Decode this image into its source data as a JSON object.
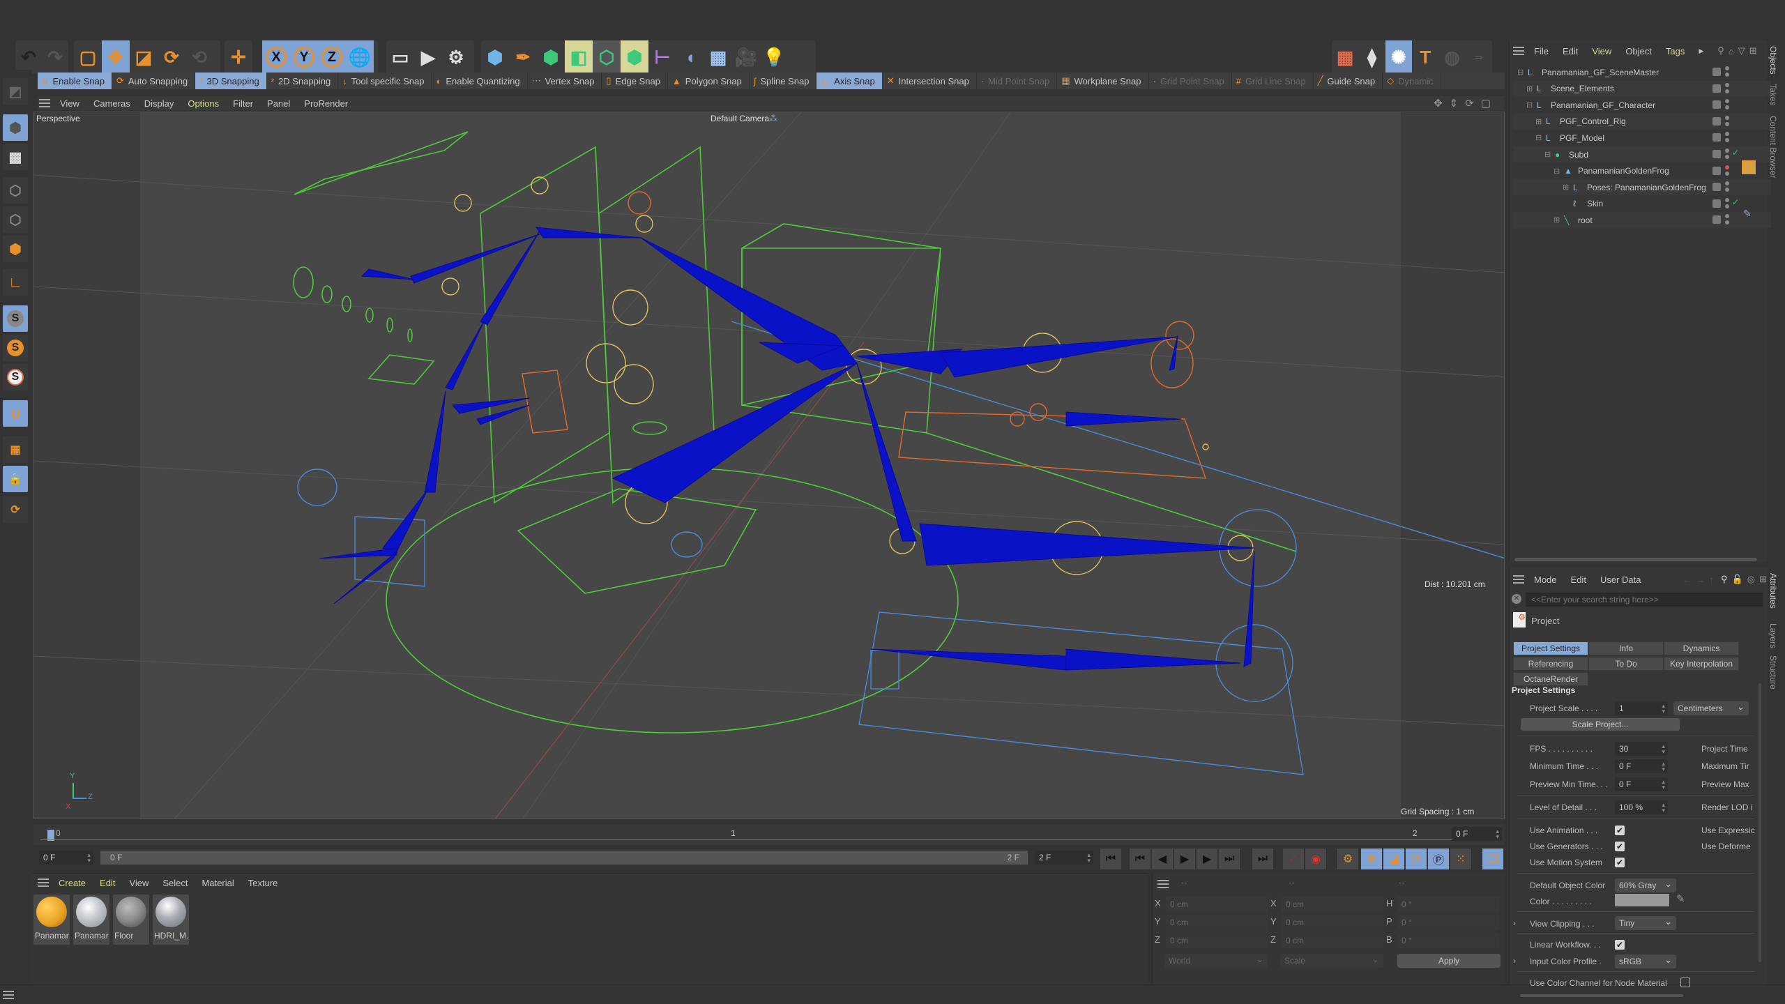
{
  "toolbar": {
    "icons": [
      "undo-icon",
      "redo-icon",
      "live-selection-icon",
      "move-icon",
      "scale-icon",
      "rotate-icon",
      "psr-icon",
      "add-icon",
      "x-axis-icon",
      "y-axis-icon",
      "z-axis-icon",
      "coordinate-system-icon",
      "render-view-icon",
      "render-picture-viewer-icon",
      "render-settings-icon",
      "cube-icon",
      "pen-icon",
      "subdivision-icon",
      "extrude-icon",
      "connect-icon",
      "array-icon",
      "symmetry-icon",
      "deformer-icon",
      "floor-icon",
      "camera-icon",
      "light-icon",
      "xpresso-icon",
      "sculpt-icon",
      "octane-icon",
      "text-icon",
      "null-icon",
      "xyz-icon"
    ],
    "axis_labels": {
      "x": "X",
      "y": "Y",
      "z": "Z"
    },
    "text_tool_glyph": "T"
  },
  "snap_bar": {
    "items": [
      {
        "label": "Enable Snap",
        "active": true,
        "disabled": false
      },
      {
        "label": "Auto Snapping",
        "active": false,
        "disabled": false
      },
      {
        "label": "3D Snapping",
        "active": true,
        "disabled": false
      },
      {
        "label": "2D Snapping",
        "active": false,
        "disabled": false
      },
      {
        "label": "Tool specific Snap",
        "active": false,
        "disabled": false
      },
      {
        "label": "Enable Quantizing",
        "active": false,
        "disabled": false
      },
      {
        "label": "Vertex Snap",
        "active": false,
        "disabled": false
      },
      {
        "label": "Edge Snap",
        "active": false,
        "disabled": false
      },
      {
        "label": "Polygon Snap",
        "active": false,
        "disabled": false
      },
      {
        "label": "Spline Snap",
        "active": false,
        "disabled": false
      },
      {
        "label": "Axis Snap",
        "active": true,
        "disabled": false
      },
      {
        "label": "Intersection Snap",
        "active": false,
        "disabled": false
      },
      {
        "label": "Mid Point Snap",
        "active": false,
        "disabled": true
      },
      {
        "label": "Workplane Snap",
        "active": false,
        "disabled": false
      },
      {
        "label": "Grid Point Snap",
        "active": false,
        "disabled": true
      },
      {
        "label": "Grid Line Snap",
        "active": false,
        "disabled": true
      },
      {
        "label": "Guide Snap",
        "active": false,
        "disabled": false
      },
      {
        "label": "Dynamic",
        "active": false,
        "disabled": true
      }
    ]
  },
  "viewport": {
    "menu": [
      "View",
      "Cameras",
      "Display",
      "Options",
      "Filter",
      "Panel",
      "ProRender"
    ],
    "highlighted_menu": "Options",
    "view_name": "Perspective",
    "camera_label": "Default Camera",
    "dist_readout": "Dist : 10.201 cm",
    "grid_spacing": "Grid Spacing : 1 cm",
    "axis_gizmo": {
      "x": "X",
      "y": "Y",
      "z": "Z"
    },
    "colors": {
      "bones": "#0a12c8",
      "guides": "#4ec93a",
      "controls": "#e0c060",
      "handles": "#e06a2a",
      "helpers": "#4a8ad8",
      "axis_line": "#c04cc0"
    }
  },
  "left_toolbar": {
    "icons": [
      "make-editable-icon",
      "model-mode-icon",
      "texture-mode-icon",
      "points-mode-icon",
      "edges-mode-icon",
      "polygons-mode-icon",
      "axis-mode-icon",
      "solo-off-icon",
      "solo-single-icon",
      "solo-hierarchy-icon",
      "snap-magnet-icon",
      "workplane-icon",
      "locked-workplane-icon",
      "align-workplane-icon"
    ],
    "solo_glyph": "S"
  },
  "object_manager": {
    "menu": [
      "File",
      "Edit",
      "View",
      "Object",
      "Tags"
    ],
    "highlighted_menus": [
      "View",
      "Tags"
    ],
    "side_tabs": [
      "Objects",
      "Takes",
      "Content Browser"
    ],
    "objects": [
      {
        "name": "Panamanian_GF_SceneMaster",
        "depth": 0,
        "expander": "minus",
        "icon": "null-icon",
        "check": false,
        "dot": "gray"
      },
      {
        "name": "Scene_Elements",
        "depth": 1,
        "expander": "plus",
        "icon": "null-icon",
        "check": false,
        "dot": "gray"
      },
      {
        "name": "Panamanian_GF_Character",
        "depth": 1,
        "expander": "minus",
        "icon": "null-icon",
        "check": false,
        "dot": "gray"
      },
      {
        "name": "PGF_Control_Rig",
        "depth": 2,
        "expander": "plus",
        "icon": "null-icon",
        "check": false,
        "dot": "gray"
      },
      {
        "name": "PGF_Model",
        "depth": 2,
        "expander": "minus",
        "icon": "null-icon",
        "check": false,
        "dot": "gray"
      },
      {
        "name": "Subd",
        "depth": 3,
        "expander": "minus",
        "icon": "subdivision-surface-icon",
        "check": true,
        "dot": "gray"
      },
      {
        "name": "PanamanianGoldenFrog",
        "depth": 4,
        "expander": "minus",
        "icon": "polygon-object-icon",
        "check": false,
        "dot": "red"
      },
      {
        "name": "Poses: PanamanianGoldenFrog",
        "depth": 5,
        "expander": "plus",
        "icon": "null-icon",
        "check": false,
        "dot": "gray"
      },
      {
        "name": "Skin",
        "depth": 5,
        "expander": "none",
        "icon": "skin-icon",
        "check": true,
        "dot": "gray"
      },
      {
        "name": "root",
        "depth": 4,
        "expander": "plus",
        "icon": "joint-icon",
        "check": false,
        "dot": "gray"
      }
    ]
  },
  "attributes": {
    "menu": [
      "Mode",
      "Edit",
      "User Data"
    ],
    "side_tabs": [
      "Attributes",
      "Layers",
      "Structure"
    ],
    "search_placeholder": "<<Enter your search string here>>",
    "object_label": "Project",
    "tabs": [
      {
        "label": "Project Settings",
        "active": true
      },
      {
        "label": "Info",
        "active": false
      },
      {
        "label": "Dynamics",
        "active": false
      },
      {
        "label": "Referencing",
        "active": false
      },
      {
        "label": "To Do",
        "active": false
      },
      {
        "label": "Key Interpolation",
        "active": false
      },
      {
        "label": "OctaneRender",
        "active": false
      }
    ],
    "section_title": "Project Settings",
    "project_scale": {
      "label": "Project Scale . . . .",
      "value": "1",
      "unit": "Centimeters"
    },
    "scale_project_button": "Scale Project...",
    "fps": {
      "label": "FPS . . . . . . . . . .",
      "value": "30"
    },
    "min_time": {
      "label": "Minimum Time . . .",
      "value": "0 F"
    },
    "preview_min": {
      "label": "Preview Min Time. . .",
      "value": "0 F"
    },
    "lod": {
      "label": "Level of Detail . . .",
      "value": "100 %"
    },
    "right_labels": [
      "Project Time",
      "Maximum Tir",
      "Preview Max",
      "Render LOD i",
      "Use Expressic",
      "Use Deforme"
    ],
    "use_animation": {
      "label": "Use Animation . . .",
      "checked": true
    },
    "use_generators": {
      "label": "Use Generators . . .",
      "checked": true
    },
    "use_motion": {
      "label": "Use Motion System",
      "checked": true
    },
    "default_color": {
      "label": "Default Object Color",
      "value": "60% Gray"
    },
    "color": {
      "label": "Color . . . . . . . . .",
      "swatch": "#999999"
    },
    "view_clipping": {
      "label": "View Clipping . . .",
      "value": "Tiny"
    },
    "linear_workflow": {
      "label": "Linear Workflow. . .",
      "checked": true
    },
    "input_profile": {
      "label": "Input Color Profile .",
      "value": "sRGB"
    },
    "node_material": {
      "label": "Use Color Channel for Node Material",
      "checked": false
    },
    "check_glyph": "✔"
  },
  "timeline": {
    "ruler_start": "0",
    "ruler_mid": "1",
    "ruler_end": "2",
    "current_frame": "0 F",
    "range_start": "0 F",
    "range_end_label": "2 F",
    "max_frame": "2 F",
    "frame_right": "0 F",
    "progress": 0.0
  },
  "material_manager": {
    "menu": [
      "Create",
      "Edit",
      "View",
      "Select",
      "Material",
      "Texture"
    ],
    "highlighted_menus": [
      "Create",
      "Edit"
    ],
    "materials": [
      {
        "name": "Panamar",
        "swatch": "#e8a020"
      },
      {
        "name": "Panamar",
        "swatch": "#c8ccd0"
      },
      {
        "name": "Floor",
        "swatch": "#8a8a8a"
      },
      {
        "name": "HDRI_M.",
        "swatch": "#a8acb4"
      }
    ]
  },
  "coordinates": {
    "header": [
      "--",
      "--",
      "--"
    ],
    "rows": [
      {
        "a_label": "X",
        "a_val": "0 cm",
        "b_label": "X",
        "b_val": "0 cm",
        "c_label": "H",
        "c_val": "0 °"
      },
      {
        "a_label": "Y",
        "a_val": "0 cm",
        "b_label": "Y",
        "b_val": "0 cm",
        "c_label": "P",
        "c_val": "0 °"
      },
      {
        "a_label": "Z",
        "a_val": "0 cm",
        "b_label": "Z",
        "b_val": "0 cm",
        "c_label": "B",
        "c_val": "0 °"
      }
    ],
    "space": "World",
    "mode": "Scale",
    "apply": "Apply"
  }
}
